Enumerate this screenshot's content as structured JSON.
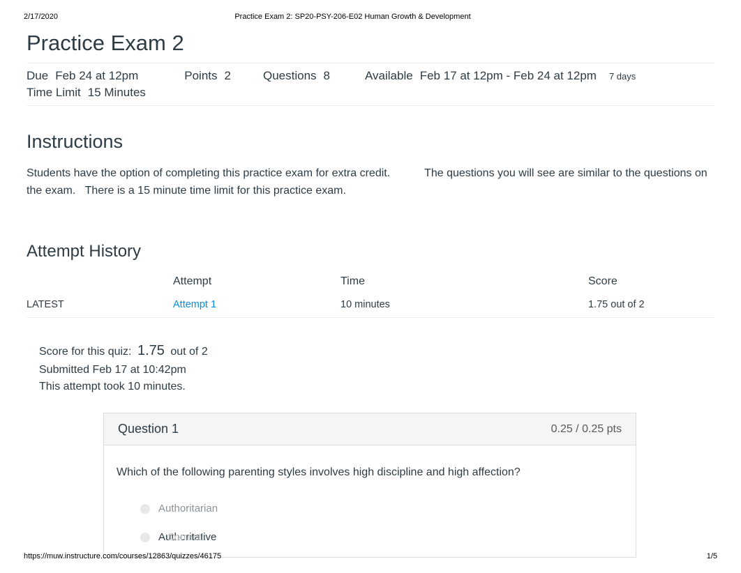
{
  "meta": {
    "date": "2/17/2020",
    "doc_title": "Practice Exam 2: SP20-PSY-206-E02 Human Growth & Development",
    "footer_url": "https://muw.instructure.com/courses/12863/quizzes/46175",
    "page_no": "1/5"
  },
  "page": {
    "title": "Practice Exam 2"
  },
  "details": {
    "due_label": "Due",
    "due_value": "Feb 24 at 12pm",
    "points_label": "Points",
    "points_value": "2",
    "questions_label": "Questions",
    "questions_value": "8",
    "available_label": "Available",
    "available_value": "Feb 17 at 12pm - Feb 24 at 12pm",
    "available_duration": "7 days",
    "time_limit_label": "Time Limit",
    "time_limit_value": "15 Minutes"
  },
  "instructions": {
    "heading": "Instructions",
    "body": "Students have the option of completing this practice exam for extra credit.           The questions you will see are similar to the questions on the exam.   There is a 15 minute time limit for this practice exam."
  },
  "attempt_history": {
    "heading": "Attempt History",
    "columns": {
      "attempt": "Attempt",
      "time": "Time",
      "score": "Score"
    },
    "row": {
      "tag": "LATEST",
      "attempt_link": "Attempt 1",
      "time": "10 minutes",
      "score": "1.75 out of 2"
    }
  },
  "score_summary": {
    "prefix": "Score for this quiz:",
    "score": "1.75",
    "suffix": "out of 2",
    "submitted": "Submitted Feb 17 at 10:42pm",
    "took": "This attempt took 10 minutes."
  },
  "question1": {
    "label": "Question 1",
    "pts": "0.25 / 0.25 pts",
    "prompt": "Which of the following parenting styles involves high discipline and high affection?",
    "answers": {
      "a1": "Authoritarian",
      "a2": "Authoritative"
    },
    "correct_label": "Correct!"
  }
}
